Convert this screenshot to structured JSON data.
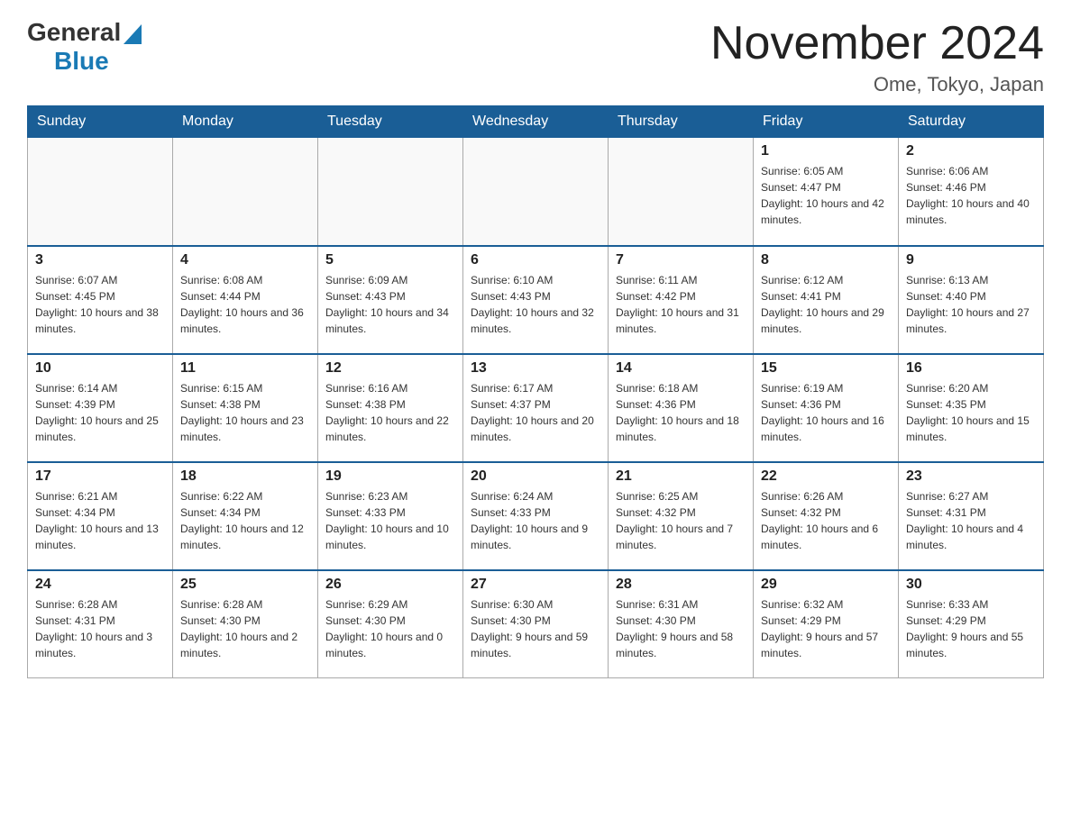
{
  "logo": {
    "text_general": "General",
    "text_blue": "Blue",
    "triangle_decoration": "▶"
  },
  "header": {
    "month_title": "November 2024",
    "location": "Ome, Tokyo, Japan"
  },
  "days_of_week": [
    "Sunday",
    "Monday",
    "Tuesday",
    "Wednesday",
    "Thursday",
    "Friday",
    "Saturday"
  ],
  "weeks": [
    [
      {
        "day": "",
        "info": ""
      },
      {
        "day": "",
        "info": ""
      },
      {
        "day": "",
        "info": ""
      },
      {
        "day": "",
        "info": ""
      },
      {
        "day": "",
        "info": ""
      },
      {
        "day": "1",
        "info": "Sunrise: 6:05 AM\nSunset: 4:47 PM\nDaylight: 10 hours and 42 minutes."
      },
      {
        "day": "2",
        "info": "Sunrise: 6:06 AM\nSunset: 4:46 PM\nDaylight: 10 hours and 40 minutes."
      }
    ],
    [
      {
        "day": "3",
        "info": "Sunrise: 6:07 AM\nSunset: 4:45 PM\nDaylight: 10 hours and 38 minutes."
      },
      {
        "day": "4",
        "info": "Sunrise: 6:08 AM\nSunset: 4:44 PM\nDaylight: 10 hours and 36 minutes."
      },
      {
        "day": "5",
        "info": "Sunrise: 6:09 AM\nSunset: 4:43 PM\nDaylight: 10 hours and 34 minutes."
      },
      {
        "day": "6",
        "info": "Sunrise: 6:10 AM\nSunset: 4:43 PM\nDaylight: 10 hours and 32 minutes."
      },
      {
        "day": "7",
        "info": "Sunrise: 6:11 AM\nSunset: 4:42 PM\nDaylight: 10 hours and 31 minutes."
      },
      {
        "day": "8",
        "info": "Sunrise: 6:12 AM\nSunset: 4:41 PM\nDaylight: 10 hours and 29 minutes."
      },
      {
        "day": "9",
        "info": "Sunrise: 6:13 AM\nSunset: 4:40 PM\nDaylight: 10 hours and 27 minutes."
      }
    ],
    [
      {
        "day": "10",
        "info": "Sunrise: 6:14 AM\nSunset: 4:39 PM\nDaylight: 10 hours and 25 minutes."
      },
      {
        "day": "11",
        "info": "Sunrise: 6:15 AM\nSunset: 4:38 PM\nDaylight: 10 hours and 23 minutes."
      },
      {
        "day": "12",
        "info": "Sunrise: 6:16 AM\nSunset: 4:38 PM\nDaylight: 10 hours and 22 minutes."
      },
      {
        "day": "13",
        "info": "Sunrise: 6:17 AM\nSunset: 4:37 PM\nDaylight: 10 hours and 20 minutes."
      },
      {
        "day": "14",
        "info": "Sunrise: 6:18 AM\nSunset: 4:36 PM\nDaylight: 10 hours and 18 minutes."
      },
      {
        "day": "15",
        "info": "Sunrise: 6:19 AM\nSunset: 4:36 PM\nDaylight: 10 hours and 16 minutes."
      },
      {
        "day": "16",
        "info": "Sunrise: 6:20 AM\nSunset: 4:35 PM\nDaylight: 10 hours and 15 minutes."
      }
    ],
    [
      {
        "day": "17",
        "info": "Sunrise: 6:21 AM\nSunset: 4:34 PM\nDaylight: 10 hours and 13 minutes."
      },
      {
        "day": "18",
        "info": "Sunrise: 6:22 AM\nSunset: 4:34 PM\nDaylight: 10 hours and 12 minutes."
      },
      {
        "day": "19",
        "info": "Sunrise: 6:23 AM\nSunset: 4:33 PM\nDaylight: 10 hours and 10 minutes."
      },
      {
        "day": "20",
        "info": "Sunrise: 6:24 AM\nSunset: 4:33 PM\nDaylight: 10 hours and 9 minutes."
      },
      {
        "day": "21",
        "info": "Sunrise: 6:25 AM\nSunset: 4:32 PM\nDaylight: 10 hours and 7 minutes."
      },
      {
        "day": "22",
        "info": "Sunrise: 6:26 AM\nSunset: 4:32 PM\nDaylight: 10 hours and 6 minutes."
      },
      {
        "day": "23",
        "info": "Sunrise: 6:27 AM\nSunset: 4:31 PM\nDaylight: 10 hours and 4 minutes."
      }
    ],
    [
      {
        "day": "24",
        "info": "Sunrise: 6:28 AM\nSunset: 4:31 PM\nDaylight: 10 hours and 3 minutes."
      },
      {
        "day": "25",
        "info": "Sunrise: 6:28 AM\nSunset: 4:30 PM\nDaylight: 10 hours and 2 minutes."
      },
      {
        "day": "26",
        "info": "Sunrise: 6:29 AM\nSunset: 4:30 PM\nDaylight: 10 hours and 0 minutes."
      },
      {
        "day": "27",
        "info": "Sunrise: 6:30 AM\nSunset: 4:30 PM\nDaylight: 9 hours and 59 minutes."
      },
      {
        "day": "28",
        "info": "Sunrise: 6:31 AM\nSunset: 4:30 PM\nDaylight: 9 hours and 58 minutes."
      },
      {
        "day": "29",
        "info": "Sunrise: 6:32 AM\nSunset: 4:29 PM\nDaylight: 9 hours and 57 minutes."
      },
      {
        "day": "30",
        "info": "Sunrise: 6:33 AM\nSunset: 4:29 PM\nDaylight: 9 hours and 55 minutes."
      }
    ]
  ]
}
